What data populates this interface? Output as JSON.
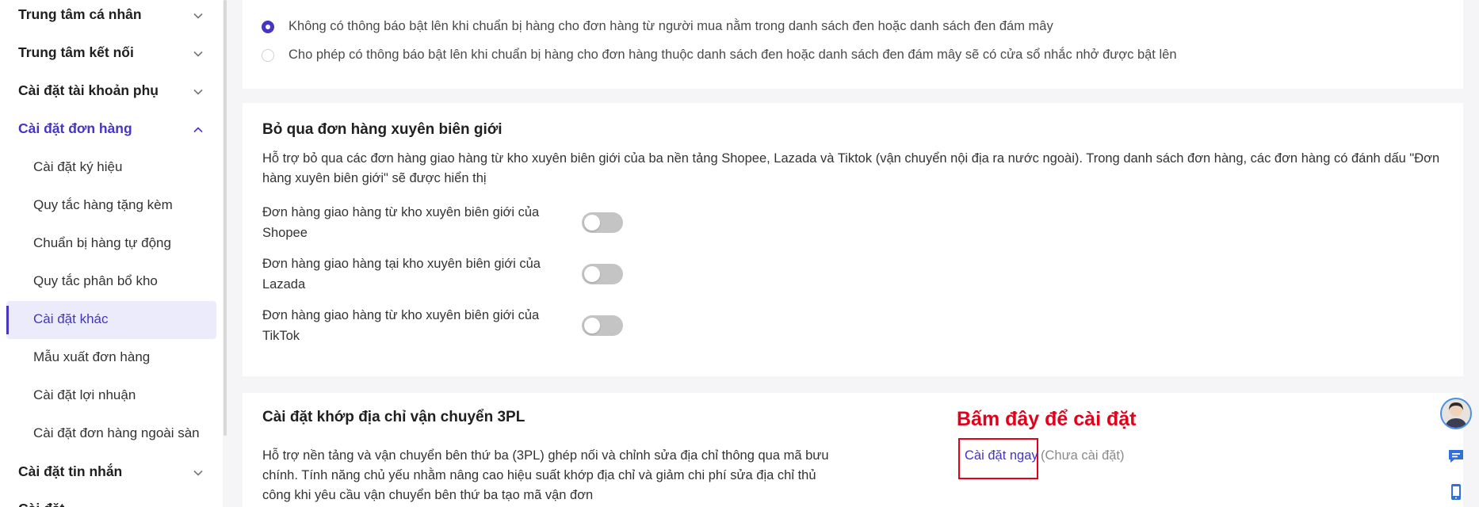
{
  "sidebar": {
    "groups": {
      "personal_center": "Trung tâm cá nhân",
      "connection_center": "Trung tâm kết nối",
      "sub_account_settings": "Cài đặt tài khoản phụ",
      "order_settings": "Cài đặt đơn hàng",
      "message_settings": "Cài đặt tin nhắn",
      "partial_next": "Cài đặt ..."
    },
    "order_items": [
      {
        "label": "Cài đặt ký hiệu"
      },
      {
        "label": "Quy tắc hàng tặng kèm"
      },
      {
        "label": "Chuẩn bị hàng tự động"
      },
      {
        "label": "Quy tắc phân bổ kho"
      },
      {
        "label": "Cài đặt khác"
      },
      {
        "label": "Mẫu xuất đơn hàng"
      },
      {
        "label": "Cài đặt lợi nhuận"
      },
      {
        "label": "Cài đặt đơn hàng ngoài sàn"
      }
    ],
    "active_item": "Cài đặt khác"
  },
  "popup_section": {
    "option1": "Không có thông báo bật lên khi chuẩn bị hàng cho đơn hàng từ người mua nằm trong danh sách đen hoặc danh sách đen đám mây",
    "option2": "Cho phép có thông báo bật lên khi chuẩn bị hàng cho đơn hàng thuộc danh sách đen hoặc danh sách đen đám mây sẽ có cửa sổ nhắc nhở được bật lên",
    "selected": 1
  },
  "cross_border": {
    "title": "Bỏ qua đơn hàng xuyên biên giới",
    "desc_line1": "Hỗ trợ bỏ qua các đơn hàng giao hàng từ kho xuyên biên giới của ba nền tảng Shopee, Lazada và Tiktok (vận chuyển nội địa ra nước ngoài). Trong danh sách đơn hàng, các đơn hàng có đánh dấu \"Đơn",
    "desc_line2": "hàng xuyên biên giới\" sẽ được hiển thị",
    "toggles": [
      {
        "line1": "Đơn hàng giao hàng từ kho xuyên biên giới của",
        "line2": "Shopee",
        "on": false
      },
      {
        "line1": "Đơn hàng giao hàng tại kho xuyên biên giới của",
        "line2": "Lazada",
        "on": false
      },
      {
        "line1": "Đơn hàng giao hàng từ kho xuyên biên giới của",
        "line2": "TikTok",
        "on": false
      }
    ]
  },
  "address_3pl": {
    "title": "Cài đặt khớp địa chỉ vận chuyển 3PL",
    "desc_line1": "Hỗ trợ nền tảng và vận chuyển bên thứ ba (3PL) ghép nối và chỉnh sửa địa chỉ thông qua mã bưu",
    "desc_line2": "chính. Tính năng chủ yếu nhằm nâng cao hiệu suất khớp địa chỉ và giảm chi phí sửa địa chỉ thủ",
    "desc_line3": "công khi yêu cầu vận chuyển bên thứ ba tạo mã vận đơn",
    "setup_link": "Cài đặt ngay",
    "setup_status": "(Chưa cài đặt)",
    "annotation": "Bấm đây để cài đặt"
  },
  "colors": {
    "accent": "#4535c4",
    "annotation_red": "#e3001b",
    "toggle_off": "#c4c4c4"
  },
  "icons": {
    "chevron": "chevron-down-icon",
    "chat": "chat-icon",
    "mobile": "mobile-icon"
  }
}
